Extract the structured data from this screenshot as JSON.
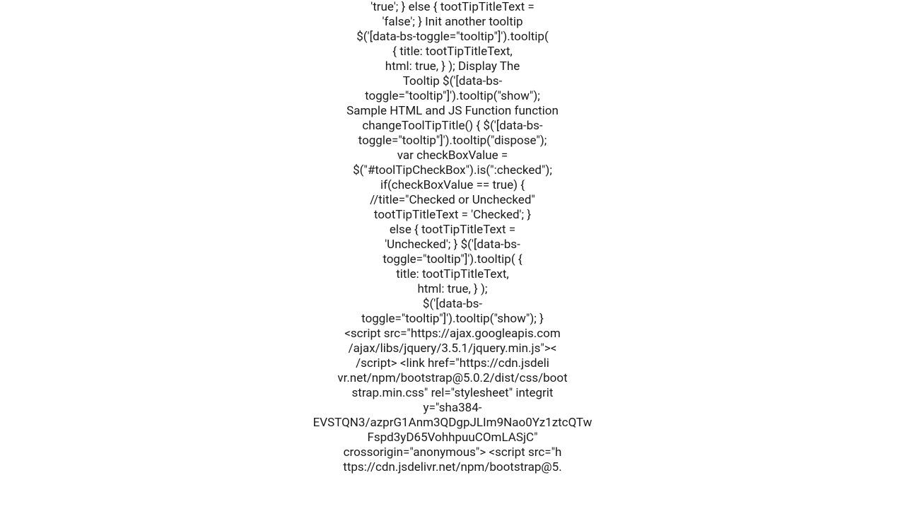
{
  "content": {
    "line1": "'true'; } else {     tootTipTitleText =",
    "line2": "'false'; }   Init another tooltip",
    "line3": "$('[data-bs-toggle=\"tooltip\"]').tooltip(",
    "line4": "{         title: tootTipTitleText,",
    "line5": "html: true,     } );   Display The",
    "line6": "Tooltip $('[data-bs-",
    "line7": "toggle=\"tooltip\"]').tooltip(\"show\");",
    "line8": "Sample HTML and JS Function     function",
    "line9": "changeToolTipTitle() {     $('[data-bs-",
    "line10": "toggle=\"tooltip\"]').tooltip(\"dispose\");",
    "line11": "var checkBoxValue =",
    "line12": "$(\"#toolTipCheckBox\").is(\":checked\");",
    "line13": "if(checkBoxValue == true)     {",
    "line14": "//title=\"Checked or Unchecked\"",
    "line15": "tootTipTitleText = 'Checked';     }",
    "line16": "else     {         tootTipTitleText =",
    "line17": "'Unchecked';     }      $('[data-bs-",
    "line18": "toggle=\"tooltip\"]').tooltip(         {",
    "line19": "title: tootTipTitleText,",
    "line20": "html: true,         }     );",
    "line21": "$('[data-bs-",
    "line22": "toggle=\"tooltip\"]').tooltip(\"show\"); }",
    "line23": "<script src=\"https://ajax.googleapis.com",
    "line24": "/ajax/libs/jquery/3.5.1/jquery.min.js\"><",
    "line25": "/script>  <link href=\"https://cdn.jsdeli",
    "line26": "vr.net/npm/bootstrap@5.0.2/dist/css/boot",
    "line27": "strap.min.css\" rel=\"stylesheet\" integrit",
    "line28": "y=\"sha384-",
    "line29": "EVSTQN3/azprG1Anm3QDgpJLIm9Nao0Yz1ztcQTw",
    "line30": "Fspd3yD65VohhpuuCOmLASjC\"",
    "line31": "crossorigin=\"anonymous\">  <script src=\"h",
    "line32": "ttps://cdn.jsdelivr.net/npm/bootstrap@5."
  }
}
